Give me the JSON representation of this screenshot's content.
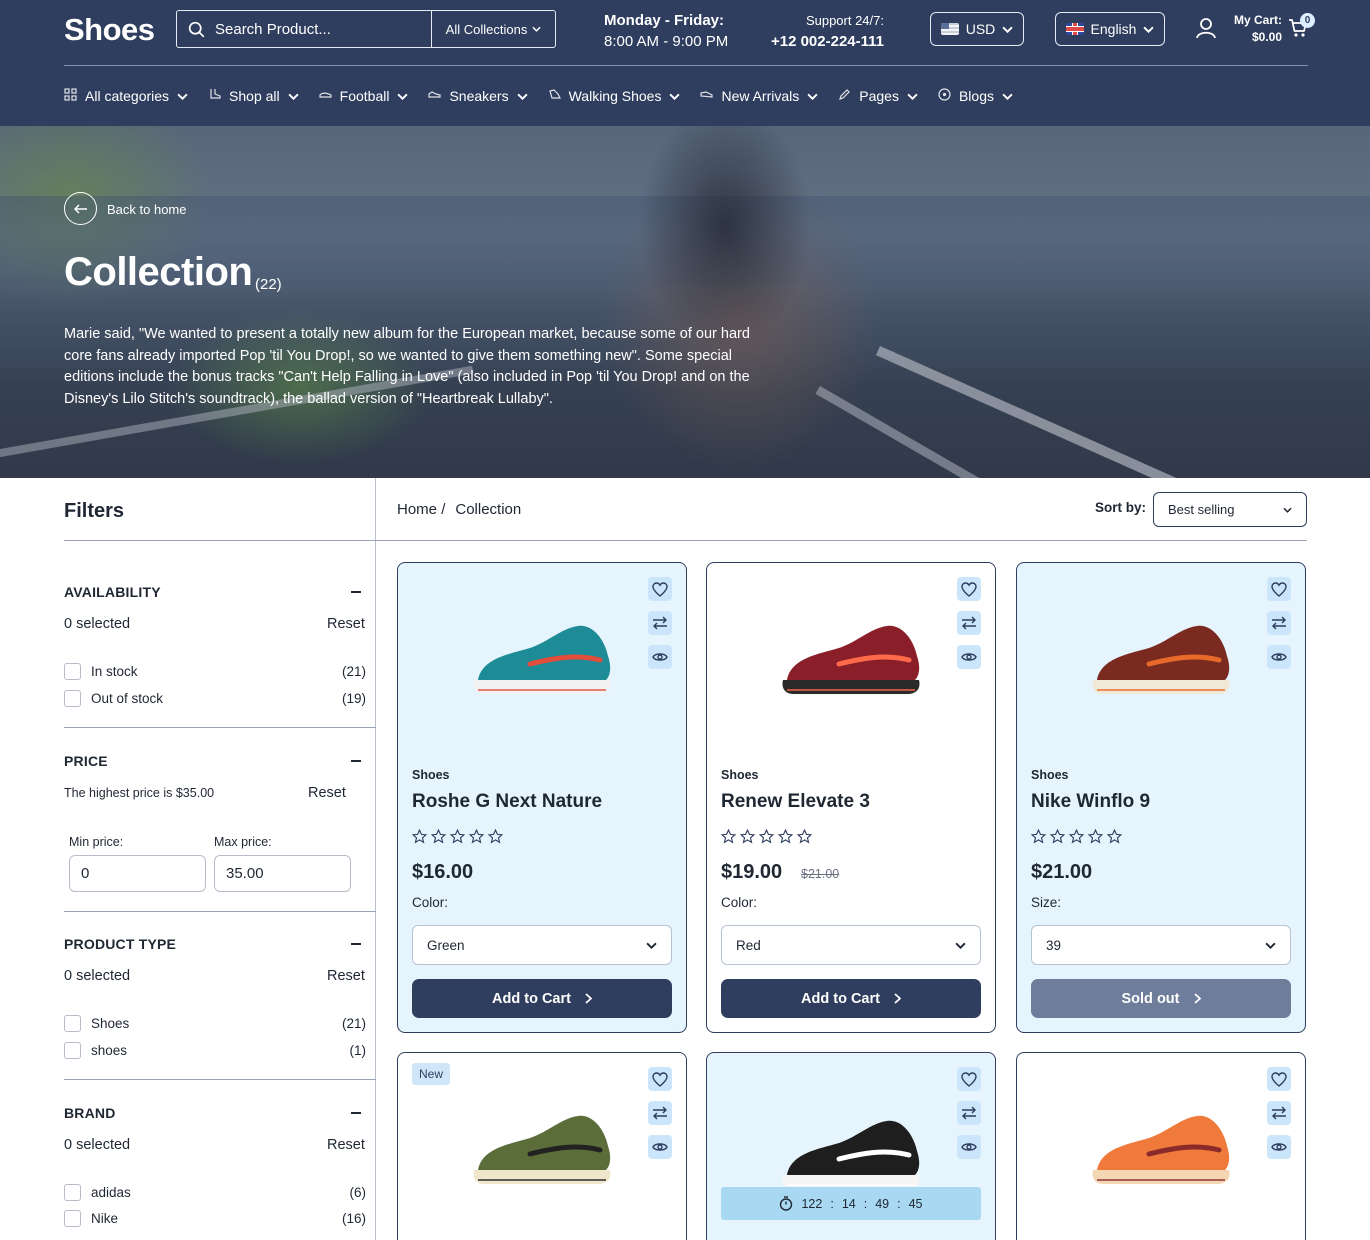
{
  "header": {
    "logo": "Shoes",
    "search_placeholder": "Search Product...",
    "collections_label": "All Collections",
    "hours_title": "Monday - Friday:",
    "hours_time": "8:00 AM - 9:00 PM",
    "support_title": "Support 24/7:",
    "support_phone": "+12 002-224-111",
    "currency": "USD",
    "language": "English",
    "cart_label": "My Cart:",
    "cart_total": "$0.00",
    "cart_count": "0"
  },
  "nav": [
    {
      "label": "All categories",
      "icon": "grid-icon"
    },
    {
      "label": "Shop all",
      "icon": "boot-icon"
    },
    {
      "label": "Football",
      "icon": "cleat-icon"
    },
    {
      "label": "Sneakers",
      "icon": "sneaker-icon"
    },
    {
      "label": "Walking Shoes",
      "icon": "walking-shoe-icon"
    },
    {
      "label": "New Arrivals",
      "icon": "slipper-icon"
    },
    {
      "label": "Pages",
      "icon": "pen-icon"
    },
    {
      "label": "Blogs",
      "icon": "compass-icon"
    }
  ],
  "hero": {
    "back_label": "Back to home",
    "title": "Collection",
    "count": "(22)",
    "description": "Marie said, \"We wanted to present a totally new album for the European market, because some of our hard core fans already imported Pop 'til You Drop!, so we wanted to give them something new\". Some special editions include the bonus tracks \"Can't Help Falling in Love\" (also included in Pop 'til You Drop! and on the Disney's Lilo Stitch's soundtrack), the ballad version of \"Heartbreak Lullaby\"."
  },
  "filters": {
    "title": "Filters",
    "availability": {
      "title": "AVAILABILITY",
      "selected": "0 selected",
      "reset": "Reset",
      "options": [
        {
          "label": "In stock",
          "count": "(21)"
        },
        {
          "label": "Out of stock",
          "count": "(19)"
        }
      ]
    },
    "price": {
      "title": "PRICE",
      "note": "The highest price is $35.00",
      "reset": "Reset",
      "min_label": "Min price:",
      "max_label": "Max price:",
      "min_value": "0",
      "max_value": "35.00"
    },
    "product_type": {
      "title": "PRODUCT TYPE",
      "selected": "0 selected",
      "reset": "Reset",
      "options": [
        {
          "label": "Shoes",
          "count": "(21)"
        },
        {
          "label": "shoes",
          "count": "(1)"
        }
      ]
    },
    "brand": {
      "title": "BRAND",
      "selected": "0 selected",
      "reset": "Reset",
      "options": [
        {
          "label": "adidas",
          "count": "(6)"
        },
        {
          "label": "Nike",
          "count": "(16)"
        }
      ]
    }
  },
  "breadcrumb": {
    "home": "Home",
    "separator": "/",
    "current": "Collection"
  },
  "sort": {
    "label": "Sort by:",
    "value": "Best selling"
  },
  "products": [
    {
      "category": "Shoes",
      "name": "Roshe G Next Nature",
      "price": "$16.00",
      "old_price": "",
      "option_label": "Color:",
      "option_value": "Green",
      "button": "Add to Cart",
      "rating": 0,
      "colors": {
        "upper": "#1e8c96",
        "accent": "#e24d3c",
        "sole": "#f2f2f2"
      }
    },
    {
      "category": "Shoes",
      "name": "Renew Elevate 3",
      "price": "$19.00",
      "old_price": "$21.00",
      "option_label": "Color:",
      "option_value": "Red",
      "button": "Add to Cart",
      "rating": 0,
      "colors": {
        "upper": "#8a1f2a",
        "accent": "#ff6b4a",
        "sole": "#2a2a2a"
      }
    },
    {
      "category": "Shoes",
      "name": "Nike Winflo 9",
      "price": "$21.00",
      "old_price": "",
      "option_label": "Size:",
      "option_value": "39",
      "button": "Sold out",
      "rating": 0,
      "colors": {
        "upper": "#7a2a1f",
        "accent": "#e76a2a",
        "sole": "#f1e8d6"
      }
    },
    {
      "badge": "New",
      "colors": {
        "upper": "#5b6e3a",
        "accent": "#222222",
        "sole": "#efe6cc"
      }
    },
    {
      "timer": [
        "122",
        "14",
        "49",
        "45"
      ],
      "colors": {
        "upper": "#1e1e1e",
        "accent": "#ffffff",
        "sole": "#f5f5f5"
      }
    },
    {
      "colors": {
        "upper": "#f07a3c",
        "accent": "#8a2a2a",
        "sole": "#f4d6b5"
      }
    }
  ],
  "colors": {
    "brand": "#2f3d5e",
    "card_tint": "#e6f4fd",
    "sold_out": "#6e7d99"
  }
}
